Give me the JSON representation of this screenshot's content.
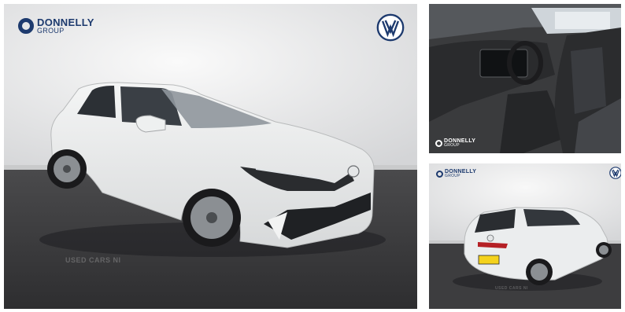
{
  "brand": {
    "name": "DONNELLY",
    "sub": "GROUP"
  },
  "watermark": "USED CARS NI",
  "photos": {
    "main": {
      "subject": "white Volkswagen Golf hatchback, front three-quarter view",
      "logo": "vw-logo-icon"
    },
    "interior": {
      "subject": "dashboard, steering wheel and front seats"
    },
    "rear": {
      "subject": "white Volkswagen Golf hatchback, rear three-quarter view",
      "logo": "vw-logo-icon"
    }
  },
  "colors": {
    "brand_navy": "#1d3a6e",
    "car_white": "#eceeee",
    "floor": "#3d3d3f",
    "backdrop": "#e4e5e6"
  }
}
